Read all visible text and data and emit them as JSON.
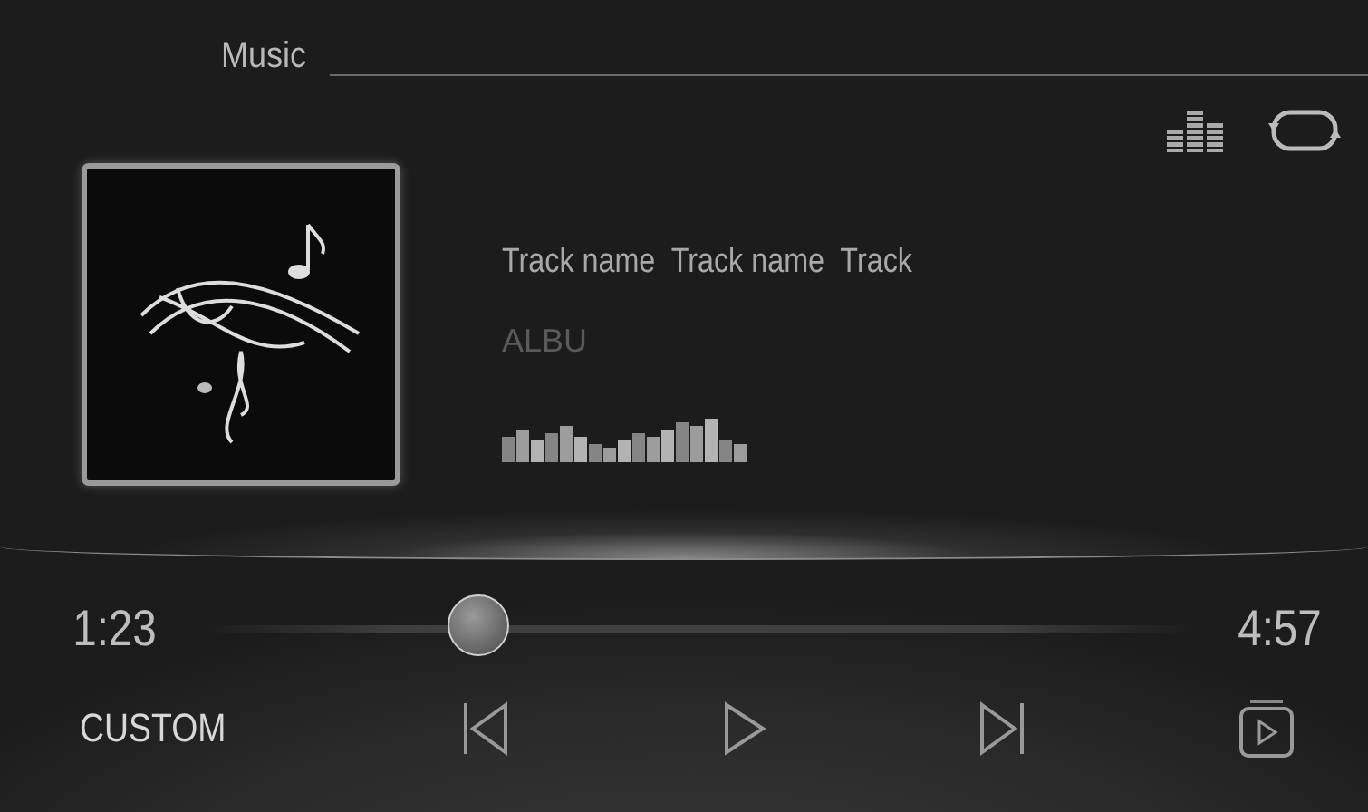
{
  "header": {
    "title": "Music"
  },
  "track": {
    "title": "Track name  Track name  Track",
    "album": "ALBU"
  },
  "progress": {
    "elapsed": "1:23",
    "total": "4:57",
    "level": 0.28
  },
  "controls": {
    "mode": "CUSTOM"
  }
}
